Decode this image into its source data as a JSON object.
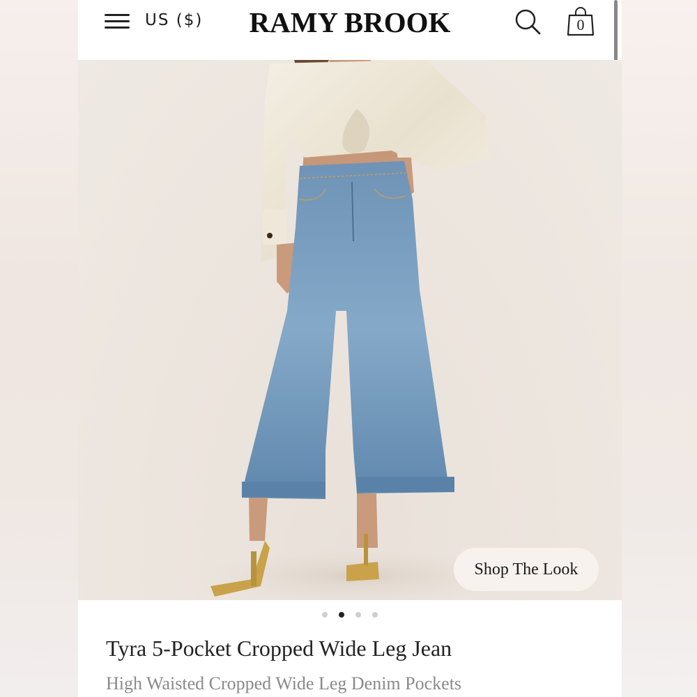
{
  "header": {
    "currency_label": "US ($)",
    "brand": "RAMY BROOK",
    "cart_count": "0"
  },
  "icons": {
    "menu": "hamburger-icon",
    "search": "search-icon",
    "cart": "shopping-bag-icon"
  },
  "hero": {
    "image_alt": "Model wearing light wash cropped wide leg jeans, cream satin tie-front shirt and gold heels",
    "shop_the_look_label": "Shop The Look"
  },
  "carousel": {
    "total": 4,
    "active_index": 1
  },
  "product": {
    "title": "Tyra 5-Pocket Cropped Wide Leg Jean",
    "subtitle": "High Waisted Cropped Wide Leg Denim Pockets"
  },
  "colors": {
    "text": "#222222",
    "muted": "#8a8a8a",
    "denim": "#6f97bb",
    "satin": "#f2ede2",
    "gold": "#c9a24a"
  }
}
